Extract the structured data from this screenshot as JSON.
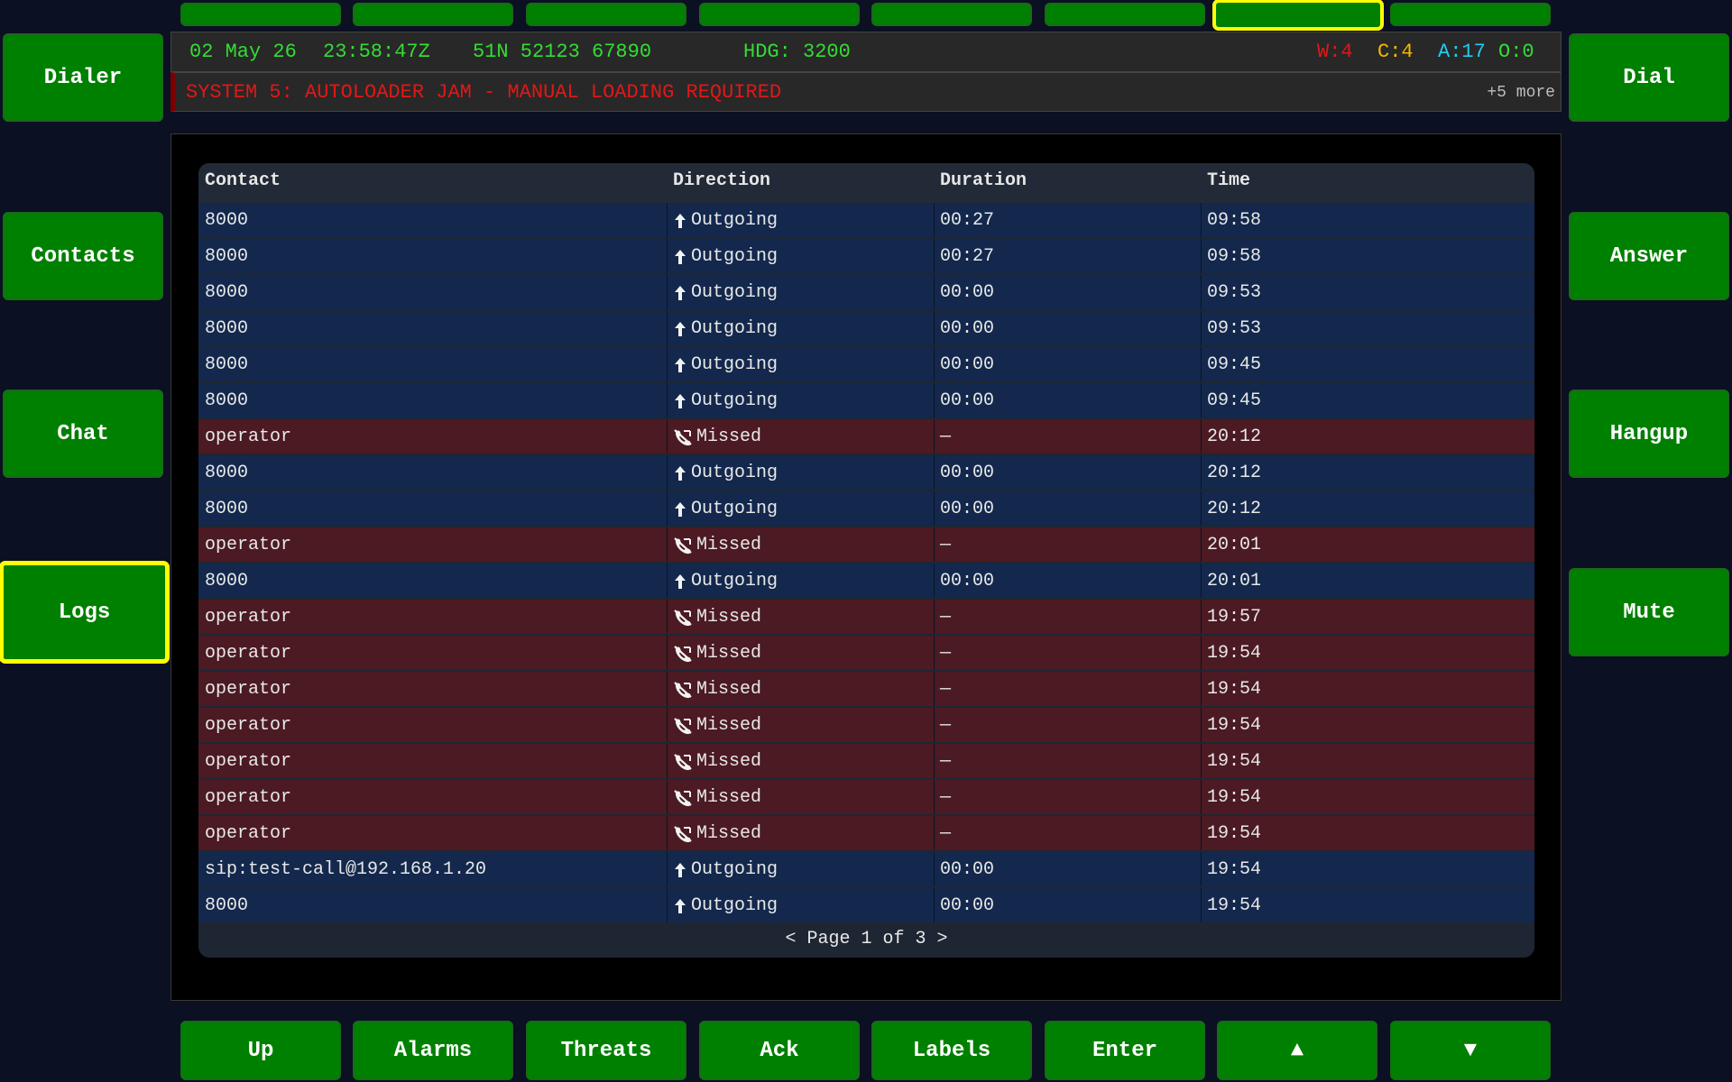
{
  "top_buttons": [
    "",
    "",
    "",
    "",
    "",
    "",
    "",
    ""
  ],
  "left_buttons": [
    "Dialer",
    "Contacts",
    "Chat",
    "Logs"
  ],
  "right_buttons": [
    "Dial",
    "Answer",
    "Hangup",
    "Mute"
  ],
  "bottom_buttons": [
    "Up",
    "Alarms",
    "Threats",
    "Ack",
    "Labels",
    "Enter",
    "▲",
    "▼"
  ],
  "status": {
    "date": "02 May 26",
    "time": "23:58:47Z",
    "position": "51N 52123 67890",
    "heading": "HDG: 3200",
    "warnings": "W:4",
    "cautions": "C:4",
    "advisories": "A:17",
    "other": "O:0",
    "colors": {
      "normal": "#33dd33",
      "warning": "#e01818",
      "caution": "#f5b800",
      "advisory": "#22ccee"
    }
  },
  "alert": {
    "message": "SYSTEM 5: AUTOLOADER JAM - MANUAL LOADING REQUIRED",
    "more": "+5 more"
  },
  "table": {
    "headers": [
      "Contact",
      "Direction",
      "Duration",
      "Time"
    ],
    "rows": [
      {
        "contact": "8000",
        "direction": "Outgoing",
        "type": "outgoing",
        "duration": "00:27",
        "time": "09:58"
      },
      {
        "contact": "8000",
        "direction": "Outgoing",
        "type": "outgoing",
        "duration": "00:27",
        "time": "09:58"
      },
      {
        "contact": "8000",
        "direction": "Outgoing",
        "type": "outgoing",
        "duration": "00:00",
        "time": "09:53"
      },
      {
        "contact": "8000",
        "direction": "Outgoing",
        "type": "outgoing",
        "duration": "00:00",
        "time": "09:53"
      },
      {
        "contact": "8000",
        "direction": "Outgoing",
        "type": "outgoing",
        "duration": "00:00",
        "time": "09:45"
      },
      {
        "contact": "8000",
        "direction": "Outgoing",
        "type": "outgoing",
        "duration": "00:00",
        "time": "09:45"
      },
      {
        "contact": "operator",
        "direction": "Missed",
        "type": "missed",
        "duration": "—",
        "time": "20:12"
      },
      {
        "contact": "8000",
        "direction": "Outgoing",
        "type": "outgoing",
        "duration": "00:00",
        "time": "20:12"
      },
      {
        "contact": "8000",
        "direction": "Outgoing",
        "type": "outgoing",
        "duration": "00:00",
        "time": "20:12"
      },
      {
        "contact": "operator",
        "direction": "Missed",
        "type": "missed",
        "duration": "—",
        "time": "20:01"
      },
      {
        "contact": "8000",
        "direction": "Outgoing",
        "type": "outgoing",
        "duration": "00:00",
        "time": "20:01"
      },
      {
        "contact": "operator",
        "direction": "Missed",
        "type": "missed",
        "duration": "—",
        "time": "19:57"
      },
      {
        "contact": "operator",
        "direction": "Missed",
        "type": "missed",
        "duration": "—",
        "time": "19:54"
      },
      {
        "contact": "operator",
        "direction": "Missed",
        "type": "missed",
        "duration": "—",
        "time": "19:54"
      },
      {
        "contact": "operator",
        "direction": "Missed",
        "type": "missed",
        "duration": "—",
        "time": "19:54"
      },
      {
        "contact": "operator",
        "direction": "Missed",
        "type": "missed",
        "duration": "—",
        "time": "19:54"
      },
      {
        "contact": "operator",
        "direction": "Missed",
        "type": "missed",
        "duration": "—",
        "time": "19:54"
      },
      {
        "contact": "operator",
        "direction": "Missed",
        "type": "missed",
        "duration": "—",
        "time": "19:54"
      },
      {
        "contact": "sip:test-call@192.168.1.20",
        "direction": "Outgoing",
        "type": "outgoing",
        "duration": "00:00",
        "time": "19:54"
      },
      {
        "contact": "8000",
        "direction": "Outgoing",
        "type": "outgoing",
        "duration": "00:00",
        "time": "19:54"
      }
    ],
    "pager": "< Page 1 of 3 >"
  },
  "icons": {
    "outgoing": "arrow-up-icon",
    "missed": "missed-call-icon"
  }
}
